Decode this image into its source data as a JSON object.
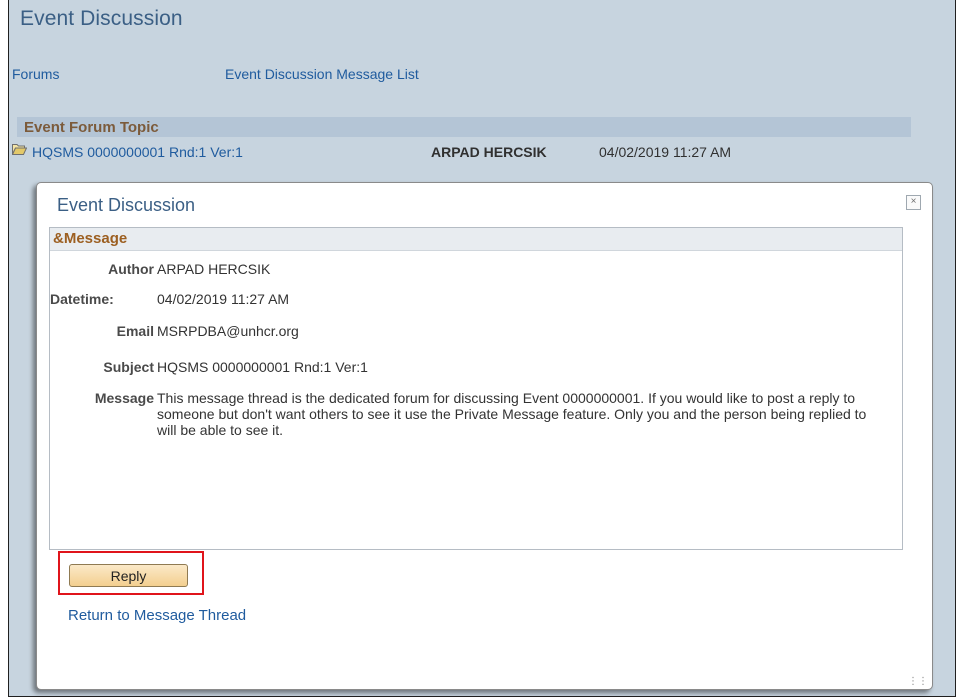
{
  "page": {
    "title": "Event Discussion",
    "breadcrumbs": [
      "Forums",
      "Event Discussion Message List"
    ]
  },
  "topic": {
    "section_label": "Event Forum Topic",
    "icon": "open-folder-icon",
    "link": "HQSMS 0000000001 Rnd:1 Ver:1",
    "author": "ARPAD HERCSIK",
    "datetime": "04/02/2019 11:27 AM"
  },
  "modal": {
    "title": "Event Discussion",
    "close_glyph": "×",
    "section_header": "&Message",
    "fields": {
      "author_label": "Author",
      "author_value": "ARPAD HERCSIK",
      "datetime_label": "Datetime:",
      "datetime_value": "04/02/2019 11:27 AM",
      "email_label": "Email",
      "email_value": "MSRPDBA@unhcr.org",
      "subject_label": "Subject",
      "subject_value": "HQSMS 0000000001 Rnd:1 Ver:1",
      "message_label": "Message",
      "message_value": "This message thread is the dedicated forum for discussing Event 0000000001.  If you would like to post a reply to someone but don't want others to see it use the Private Message feature.  Only you and the person being replied to will be able to see it."
    },
    "reply_button_label": "Reply",
    "return_link": "Return to Message Thread"
  },
  "colors": {
    "page_background": "#c7d4df",
    "link": "#1f5b9e",
    "title": "#3b5f85",
    "section_header": "#9c5f21",
    "highlight_border": "#e0141b",
    "button_gradient": [
      "#fbe9c8",
      "#f3cf8f"
    ]
  }
}
